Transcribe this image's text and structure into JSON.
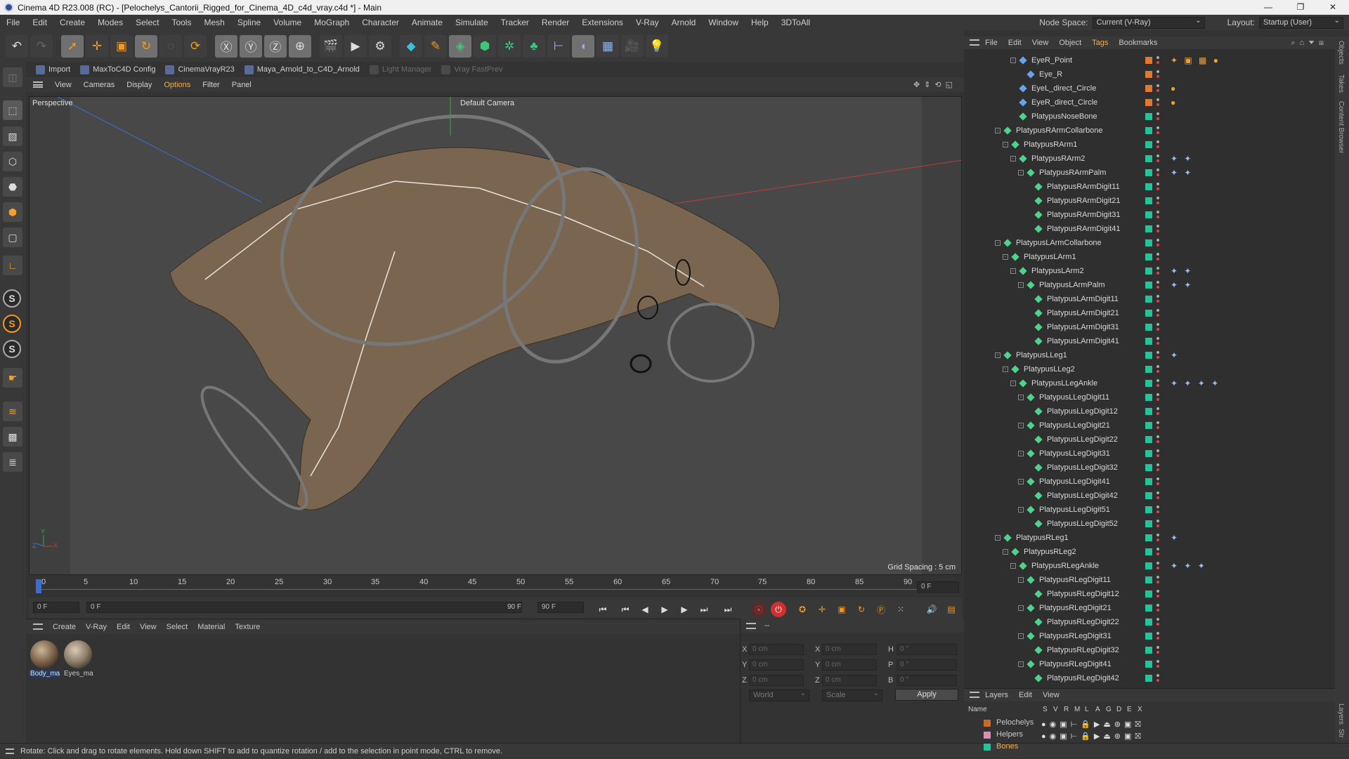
{
  "window": {
    "title": "Cinema 4D R23.008 (RC) - [Pelochelys_Cantorii_Rigged_for_Cinema_4D_c4d_vray.c4d *] - Main",
    "controls": [
      "—",
      "❐",
      "✕"
    ]
  },
  "menubar": {
    "items": [
      "File",
      "Edit",
      "Create",
      "Modes",
      "Select",
      "Tools",
      "Mesh",
      "Spline",
      "Volume",
      "MoGraph",
      "Character",
      "Animate",
      "Simulate",
      "Tracker",
      "Render",
      "Extensions",
      "V-Ray",
      "Arnold",
      "Window",
      "Help",
      "3DToAll"
    ],
    "node_space_label": "Node Space:",
    "node_space_value": "Current (V-Ray)",
    "layout_label": "Layout:",
    "layout_value": "Startup (User)"
  },
  "pluginbar": {
    "items": [
      {
        "label": "Import",
        "enabled": true
      },
      {
        "label": "MaxToC4D Config",
        "enabled": true
      },
      {
        "label": "CinemaVrayR23",
        "enabled": true
      },
      {
        "label": "Maya_Arnold_to_C4D_Arnold",
        "enabled": true
      },
      {
        "label": "Light Manager",
        "enabled": false
      },
      {
        "label": "Vray FastPrev",
        "enabled": false
      }
    ]
  },
  "viewport_menu": {
    "items": [
      "View",
      "Cameras",
      "Display",
      "Options",
      "Filter",
      "Panel"
    ],
    "highlighted": "Options"
  },
  "viewport": {
    "label": "Perspective",
    "camera": "Default Camera",
    "grid_spacing": "Grid Spacing : 5 cm",
    "axis_x": "X",
    "axis_y": "Y",
    "axis_z": "Z"
  },
  "timeline": {
    "ticks": [
      "0",
      "5",
      "10",
      "15",
      "20",
      "25",
      "30",
      "35",
      "40",
      "45",
      "50",
      "55",
      "60",
      "65",
      "70",
      "75",
      "80",
      "85",
      "90"
    ],
    "current_frame_field": "0 F",
    "start_field": "0 F",
    "range_start": "0 F",
    "range_end": "90 F",
    "end_field": "90 F",
    "end_field2": "90 F"
  },
  "material_panel": {
    "menu": [
      "Create",
      "V-Ray",
      "Edit",
      "View",
      "Select",
      "Material",
      "Texture"
    ],
    "materials": [
      "Body_ma",
      "Eyes_ma"
    ]
  },
  "attributes": {
    "header": "--",
    "rows": [
      {
        "axis": "X",
        "pos": "0 cm",
        "axis2": "X",
        "size": "0 cm",
        "axis3": "H",
        "rot": "0 °"
      },
      {
        "axis": "Y",
        "pos": "0 cm",
        "axis2": "Y",
        "size": "0 cm",
        "axis3": "P",
        "rot": "0 °"
      },
      {
        "axis": "Z",
        "pos": "0 cm",
        "axis2": "Z",
        "size": "0 cm",
        "axis3": "B",
        "rot": "0 °"
      }
    ],
    "coord_mode": "World",
    "transform_mode": "Scale",
    "apply_label": "Apply"
  },
  "status": "Rotate: Click and drag to rotate elements. Hold down SHIFT to add to quantize rotation / add to the selection in point mode, CTRL to remove.",
  "object_manager": {
    "menu": [
      "File",
      "Edit",
      "View",
      "Object",
      "Tags",
      "Bookmarks"
    ],
    "highlighted": "Tags",
    "rows": [
      {
        "name": "EyeR_Point",
        "indent": 4,
        "color": "#e07a2e",
        "expander": "-",
        "tags": "✦ ▣ ▦ ●"
      },
      {
        "name": "Eye_R",
        "indent": 5,
        "color": "#e07a2e",
        "expander": "",
        "tags": ""
      },
      {
        "name": "EyeL_direct_Circle",
        "indent": 4,
        "color": "#e07a2e",
        "expander": "",
        "tags": "●"
      },
      {
        "name": "EyeR_direct_Circle",
        "indent": 4,
        "color": "#e07a2e",
        "expander": "",
        "tags": "●"
      },
      {
        "name": "PlatypusNoseBone",
        "indent": 4,
        "color": "#23c49a",
        "expander": "",
        "tags": ""
      },
      {
        "name": "PlatypusRArmCollarbone",
        "indent": 2,
        "color": "#23c49a",
        "expander": "-",
        "tags": ""
      },
      {
        "name": "PlatypusRArm1",
        "indent": 3,
        "color": "#23c49a",
        "expander": "-",
        "tags": ""
      },
      {
        "name": "PlatypusRArm2",
        "indent": 4,
        "color": "#23c49a",
        "expander": "-",
        "tags": "✦ ✦"
      },
      {
        "name": "PlatypusRArmPalm",
        "indent": 5,
        "color": "#23c49a",
        "expander": "-",
        "tags": "✦ ✦"
      },
      {
        "name": "PlatypusRArmDigit11",
        "indent": 6,
        "color": "#23c49a",
        "expander": "",
        "tags": ""
      },
      {
        "name": "PlatypusRArmDigit21",
        "indent": 6,
        "color": "#23c49a",
        "expander": "",
        "tags": ""
      },
      {
        "name": "PlatypusRArmDigit31",
        "indent": 6,
        "color": "#23c49a",
        "expander": "",
        "tags": ""
      },
      {
        "name": "PlatypusRArmDigit41",
        "indent": 6,
        "color": "#23c49a",
        "expander": "",
        "tags": ""
      },
      {
        "name": "PlatypusLArmCollarbone",
        "indent": 2,
        "color": "#23c49a",
        "expander": "-",
        "tags": ""
      },
      {
        "name": "PlatypusLArm1",
        "indent": 3,
        "color": "#23c49a",
        "expander": "-",
        "tags": ""
      },
      {
        "name": "PlatypusLArm2",
        "indent": 4,
        "color": "#23c49a",
        "expander": "-",
        "tags": "✦ ✦"
      },
      {
        "name": "PlatypusLArmPalm",
        "indent": 5,
        "color": "#23c49a",
        "expander": "-",
        "tags": "✦ ✦"
      },
      {
        "name": "PlatypusLArmDigit11",
        "indent": 6,
        "color": "#23c49a",
        "expander": "",
        "tags": ""
      },
      {
        "name": "PlatypusLArmDigit21",
        "indent": 6,
        "color": "#23c49a",
        "expander": "",
        "tags": ""
      },
      {
        "name": "PlatypusLArmDigit31",
        "indent": 6,
        "color": "#23c49a",
        "expander": "",
        "tags": ""
      },
      {
        "name": "PlatypusLArmDigit41",
        "indent": 6,
        "color": "#23c49a",
        "expander": "",
        "tags": ""
      },
      {
        "name": "PlatypusLLeg1",
        "indent": 2,
        "color": "#23c49a",
        "expander": "-",
        "tags": "✦"
      },
      {
        "name": "PlatypusLLeg2",
        "indent": 3,
        "color": "#23c49a",
        "expander": "-",
        "tags": ""
      },
      {
        "name": "PlatypusLLegAnkle",
        "indent": 4,
        "color": "#23c49a",
        "expander": "-",
        "tags": "✦ ✦ ✦ ✦"
      },
      {
        "name": "PlatypusLLegDigit11",
        "indent": 5,
        "color": "#23c49a",
        "expander": "-",
        "tags": ""
      },
      {
        "name": "PlatypusLLegDigit12",
        "indent": 6,
        "color": "#23c49a",
        "expander": "",
        "tags": ""
      },
      {
        "name": "PlatypusLLegDigit21",
        "indent": 5,
        "color": "#23c49a",
        "expander": "-",
        "tags": ""
      },
      {
        "name": "PlatypusLLegDigit22",
        "indent": 6,
        "color": "#23c49a",
        "expander": "",
        "tags": ""
      },
      {
        "name": "PlatypusLLegDigit31",
        "indent": 5,
        "color": "#23c49a",
        "expander": "-",
        "tags": ""
      },
      {
        "name": "PlatypusLLegDigit32",
        "indent": 6,
        "color": "#23c49a",
        "expander": "",
        "tags": ""
      },
      {
        "name": "PlatypusLLegDigit41",
        "indent": 5,
        "color": "#23c49a",
        "expander": "-",
        "tags": ""
      },
      {
        "name": "PlatypusLLegDigit42",
        "indent": 6,
        "color": "#23c49a",
        "expander": "",
        "tags": ""
      },
      {
        "name": "PlatypusLLegDigit51",
        "indent": 5,
        "color": "#23c49a",
        "expander": "-",
        "tags": ""
      },
      {
        "name": "PlatypusLLegDigit52",
        "indent": 6,
        "color": "#23c49a",
        "expander": "",
        "tags": ""
      },
      {
        "name": "PlatypusRLeg1",
        "indent": 2,
        "color": "#23c49a",
        "expander": "-",
        "tags": "✦"
      },
      {
        "name": "PlatypusRLeg2",
        "indent": 3,
        "color": "#23c49a",
        "expander": "-",
        "tags": ""
      },
      {
        "name": "PlatypusRLegAnkle",
        "indent": 4,
        "color": "#23c49a",
        "expander": "-",
        "tags": "✦ ✦ ✦"
      },
      {
        "name": "PlatypusRLegDigit11",
        "indent": 5,
        "color": "#23c49a",
        "expander": "-",
        "tags": ""
      },
      {
        "name": "PlatypusRLegDigit12",
        "indent": 6,
        "color": "#23c49a",
        "expander": "",
        "tags": ""
      },
      {
        "name": "PlatypusRLegDigit21",
        "indent": 5,
        "color": "#23c49a",
        "expander": "-",
        "tags": ""
      },
      {
        "name": "PlatypusRLegDigit22",
        "indent": 6,
        "color": "#23c49a",
        "expander": "",
        "tags": ""
      },
      {
        "name": "PlatypusRLegDigit31",
        "indent": 5,
        "color": "#23c49a",
        "expander": "-",
        "tags": ""
      },
      {
        "name": "PlatypusRLegDigit32",
        "indent": 6,
        "color": "#23c49a",
        "expander": "",
        "tags": ""
      },
      {
        "name": "PlatypusRLegDigit41",
        "indent": 5,
        "color": "#23c49a",
        "expander": "-",
        "tags": ""
      },
      {
        "name": "PlatypusRLegDigit42",
        "indent": 6,
        "color": "#23c49a",
        "expander": "",
        "tags": ""
      }
    ]
  },
  "layers": {
    "menu": [
      "Layers",
      "Edit",
      "View"
    ],
    "columns": [
      "Name",
      "S",
      "V",
      "R",
      "M",
      "L",
      "A",
      "G",
      "D",
      "E",
      "X"
    ],
    "rows": [
      {
        "name": "Pelochelys",
        "color": "#c96a2b"
      },
      {
        "name": "Helpers",
        "color": "#d68fb6"
      },
      {
        "name": "Bones",
        "color": "#23c49a",
        "highlight": true
      }
    ]
  },
  "right_strip": [
    "Objects",
    "Takes",
    "Content Browser",
    "Layers",
    "Str"
  ]
}
